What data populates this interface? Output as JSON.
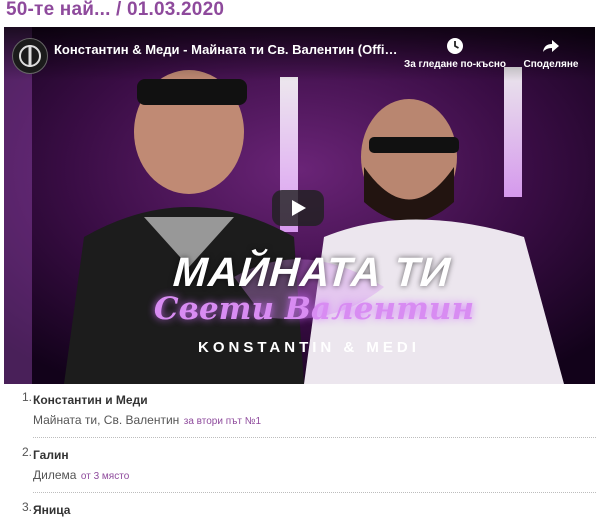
{
  "page": {
    "title": "50-те най... / 01.03.2020"
  },
  "video": {
    "title": "Константин & Меди - Майната ти Св. Валентин (Official...",
    "watch_later_label": "За гледане по-късно",
    "share_label": "Споделяне",
    "art_title": "МАЙНАТА ТИ",
    "art_subtitle": "Свети Валентин",
    "art_artists": "KONSTANTIN & MEDI"
  },
  "chart": {
    "entries": [
      {
        "rank": "1.",
        "artist": "Константин и Меди",
        "song": "Майната ти, Св. Валентин",
        "note": "за втори път №1"
      },
      {
        "rank": "2.",
        "artist": "Галин",
        "song": "Дилема",
        "note": "от 3 място"
      },
      {
        "rank": "3.",
        "artist": "Яница",
        "song": "",
        "note": ""
      }
    ]
  },
  "colors": {
    "accent": "#8e4a9c",
    "video_bg": "#1a0420",
    "neon": "#d88cf2"
  }
}
